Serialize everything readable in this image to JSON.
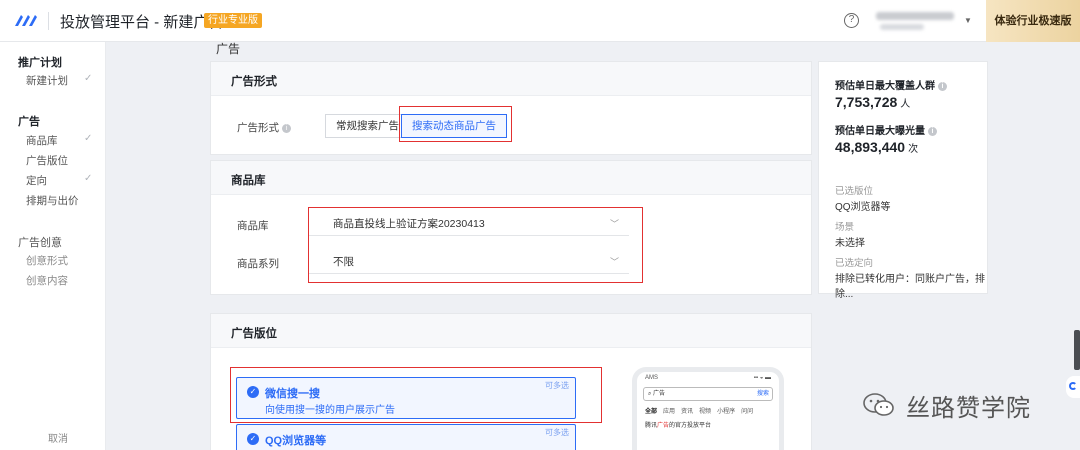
{
  "header": {
    "app_title": "投放管理平台 - 新建广告",
    "badge": "行业专业版",
    "help_icon": "question-circle-icon",
    "trial_button": "体验行业极速版"
  },
  "sidebar": {
    "group1": "推广计划",
    "new_plan": "新建计划",
    "group2": "广告",
    "items": [
      "商品库",
      "广告版位",
      "定向",
      "排期与出价"
    ],
    "group3": "广告创意",
    "creative_items": [
      "创意形式",
      "创意内容"
    ],
    "cancel": "取消",
    "check": "✓"
  },
  "main": {
    "section_label": "广告",
    "ad_format": {
      "title": "广告形式",
      "field_label": "广告形式",
      "options": [
        "常规搜索广告",
        "搜索动态商品广告"
      ],
      "selected": "搜索动态商品广告"
    },
    "catalog": {
      "title": "商品库",
      "library_label": "商品库",
      "library_value": "商品直投线上验证方案20230413",
      "series_label": "商品系列",
      "series_value": "不限"
    },
    "placement": {
      "title": "广告版位",
      "options": [
        {
          "title": "微信搜一搜",
          "desc": "向使用搜一搜的用户展示广告",
          "tag": "可多选"
        },
        {
          "title": "QQ浏览器等",
          "tag": "可多选"
        }
      ]
    }
  },
  "estimate": {
    "reach_label": "预估单日最大覆盖人群",
    "reach_value": "7,753,728",
    "reach_unit": "人",
    "exposure_label": "预估单日最大曝光量",
    "exposure_value": "48,893,440",
    "exposure_unit": "次",
    "placement_key": "已选版位",
    "placement_value": "QQ浏览器等",
    "scene_key": "场景",
    "scene_value": "未选择",
    "targeting_key": "已选定向",
    "targeting_value": "排除已转化用户：同账户广告，排除..."
  },
  "phone_preview": {
    "status": "AMS",
    "signal": "▪▪ ◒ ▬",
    "search_text": "广告",
    "search_button": "搜索",
    "tabs": [
      "全部",
      "应用",
      "资讯",
      "视频",
      "小程序",
      "问问"
    ],
    "ad_prefix": "腾讯",
    "ad_highlight": "广告",
    "ad_suffix": "的官方投放平台"
  },
  "watermark": {
    "text": "丝路赞学院"
  },
  "colors": {
    "accent": "#2d6cf6",
    "highlight_box": "#e23131",
    "badge": "#f5a623"
  }
}
